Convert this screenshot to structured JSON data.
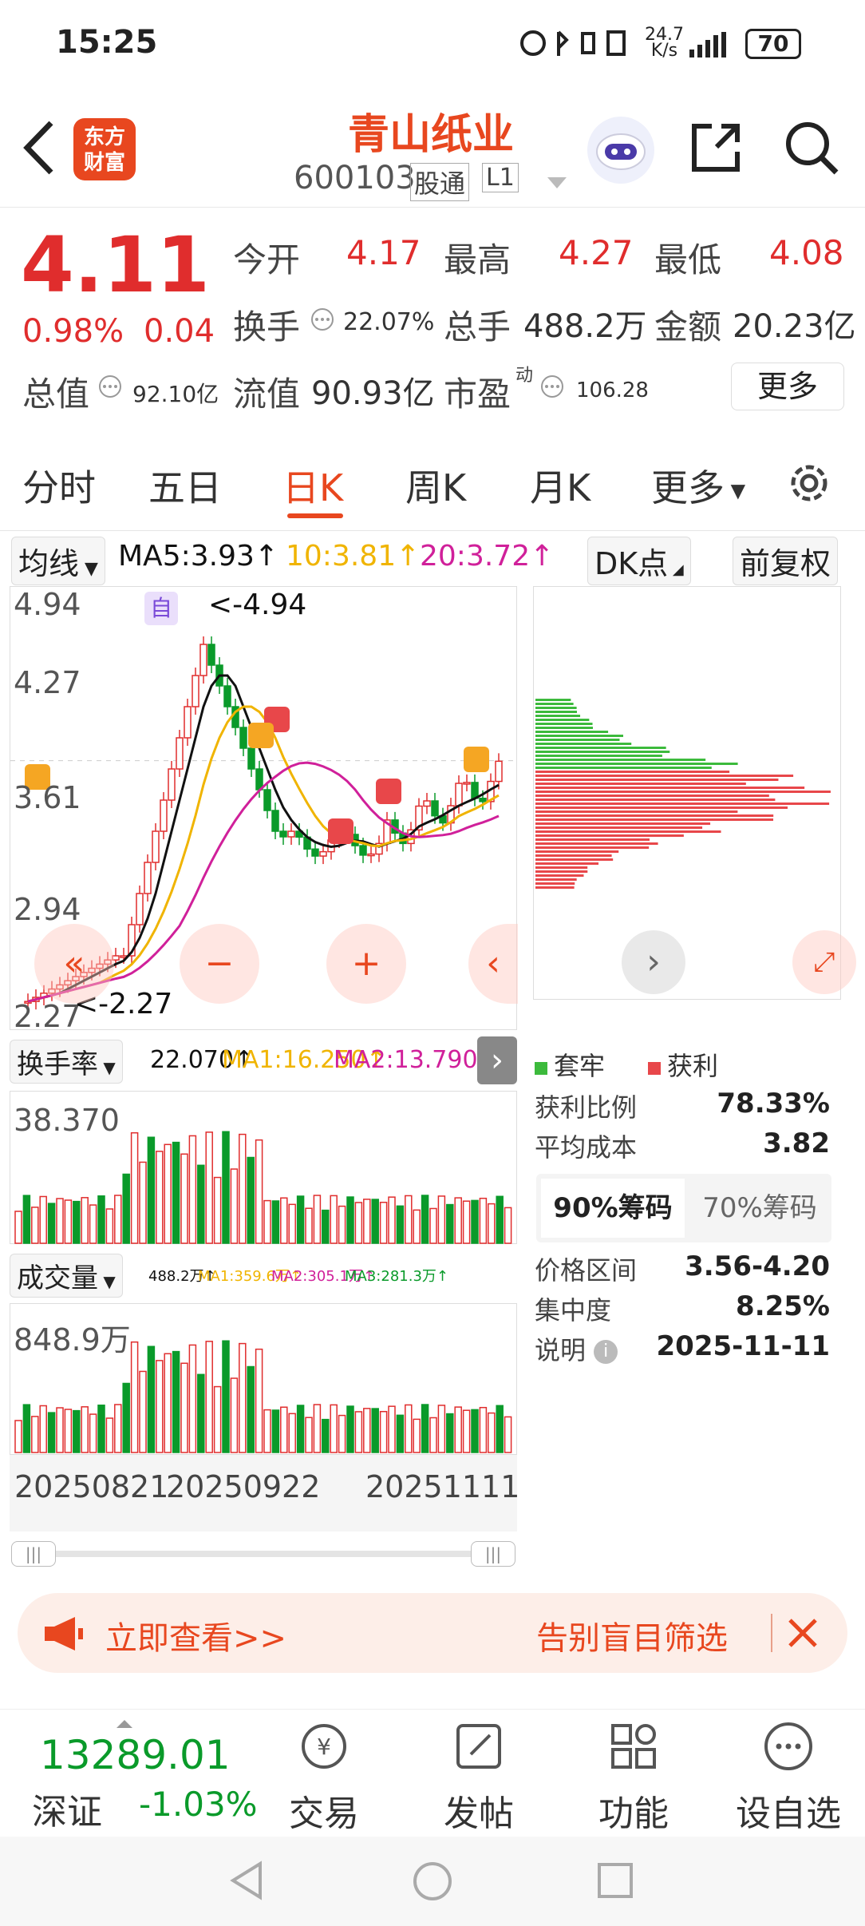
{
  "status": {
    "time": "15:25",
    "speed_top": "24.7",
    "speed_unit": "K/s",
    "battery": "70"
  },
  "header": {
    "name": "青山纸业",
    "code": "600103",
    "tag_connect": "股通",
    "tag_level": "L1",
    "brand_line1": "东方",
    "brand_line2": "财富"
  },
  "quote": {
    "price": "4.11",
    "pct": "0.98%",
    "chg": "0.04",
    "open_label": "今开",
    "open": "4.17",
    "high_label": "最高",
    "high": "4.27",
    "low_label": "最低",
    "low": "4.08",
    "turnover_label": "换手",
    "turnover": "22.07%",
    "vol_label": "总手",
    "vol": "488.2万",
    "amt_label": "金额",
    "amt": "20.23亿",
    "mcap_label": "总值",
    "mcap": "92.10亿",
    "float_label": "流值",
    "float": "90.93亿",
    "pe_label": "市盈",
    "pe_sup": "动",
    "pe": "106.28",
    "more": "更多"
  },
  "tabs": [
    "分时",
    "五日",
    "日K",
    "周K",
    "月K",
    "更多"
  ],
  "active_tab": "日K",
  "ma": {
    "select": "均线",
    "ma5": "MA5:3.93↑",
    "ma10": "10:3.81↑",
    "ma20": "20:3.72↑",
    "dk": "DK点",
    "fq": "前复权"
  },
  "kline": {
    "y_ticks": [
      "4.94",
      "4.27",
      "3.61",
      "2.94",
      "2.27"
    ],
    "hi_label": "<-4.94",
    "lo_label": "<-2.27",
    "auto": "自"
  },
  "turnover_ind": {
    "select": "换手率",
    "v": "22.070↑",
    "ma1": "MA1:16.250↑",
    "ma2": "MA2:13.790↑",
    "max": "38.370"
  },
  "volume_ind": {
    "select": "成交量",
    "v": "488.2万↑",
    "ma1": "MA1:359.6万↑",
    "ma2": "MA2:305.1万↑",
    "ma3": "MA3:281.3万↑",
    "max": "848.9万"
  },
  "dates": [
    "20250821",
    "20250922",
    "20251111"
  ],
  "chips": {
    "legend_trap": "套牢",
    "legend_profit": "获利",
    "profit_ratio_label": "获利比例",
    "profit_ratio": "78.33%",
    "avg_cost_label": "平均成本",
    "avg_cost": "3.82",
    "tab90": "90%筹码",
    "tab70": "70%筹码",
    "range_label": "价格区间",
    "range": "3.56-4.20",
    "conc_label": "集中度",
    "conc": "8.25%",
    "note_label": "说明",
    "note": "2025-11-11"
  },
  "ad": {
    "left": "立即查看>>",
    "right": "告别盲目筛选"
  },
  "bottom": {
    "index_value": "13289.01",
    "index_name": "深证",
    "index_pct": "-1.03%",
    "trade": "交易",
    "post": "发帖",
    "func": "功能",
    "watch": "设自选"
  },
  "colors": {
    "up": "#e02d2d",
    "down": "#0a9a2a",
    "accent": "#e8471f",
    "ma5": "#111111",
    "ma10": "#f0b400",
    "ma20": "#d0209a"
  }
}
